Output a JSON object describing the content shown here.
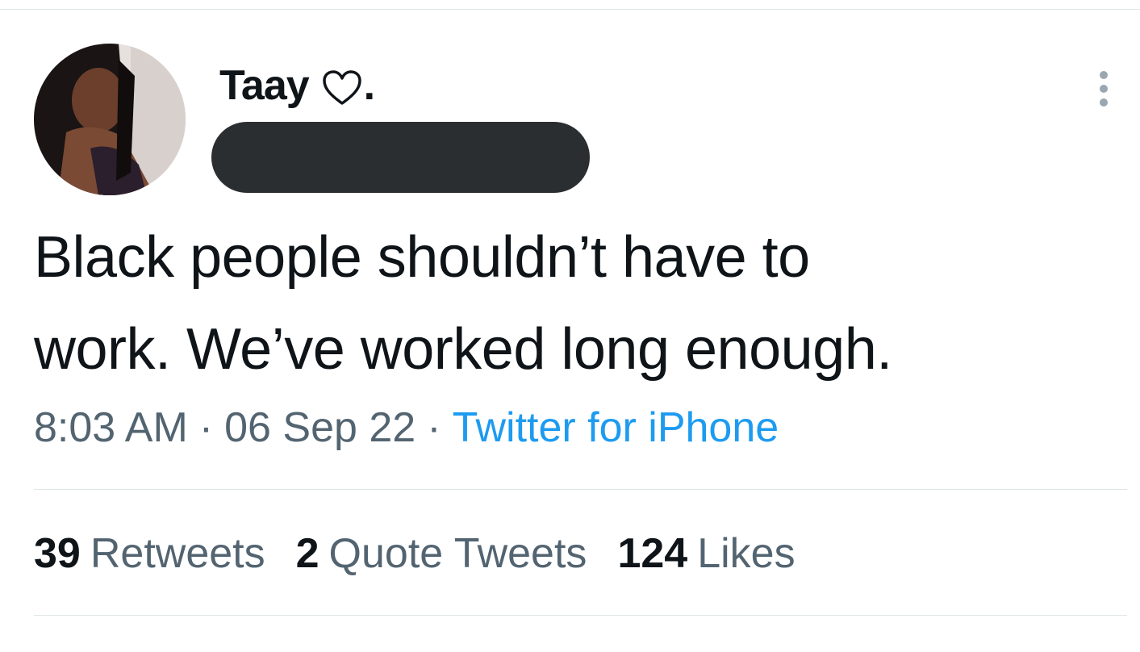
{
  "tweet": {
    "author": {
      "display_name": "Taay",
      "name_suffix": ".",
      "emoji_icon": "white-heart-icon",
      "handle_redacted": true
    },
    "text": "Black people shouldn’t have to\nwork. We’ve worked long enough.",
    "meta": {
      "time": "8:03 AM",
      "separator": "·",
      "date": "06 Sep 22",
      "source": "Twitter for iPhone"
    },
    "stats": {
      "retweets_count": "39",
      "retweets_label": "Retweets",
      "quotes_count": "2",
      "quotes_label": "Quote Tweets",
      "likes_count": "124",
      "likes_label": "Likes"
    },
    "more_icon": "more-vertical-icon"
  },
  "colors": {
    "text_primary": "#0f1419",
    "text_secondary": "#536471",
    "link": "#1d9bf0",
    "divider": "#dfe6e3",
    "redaction": "#2a2e31"
  }
}
